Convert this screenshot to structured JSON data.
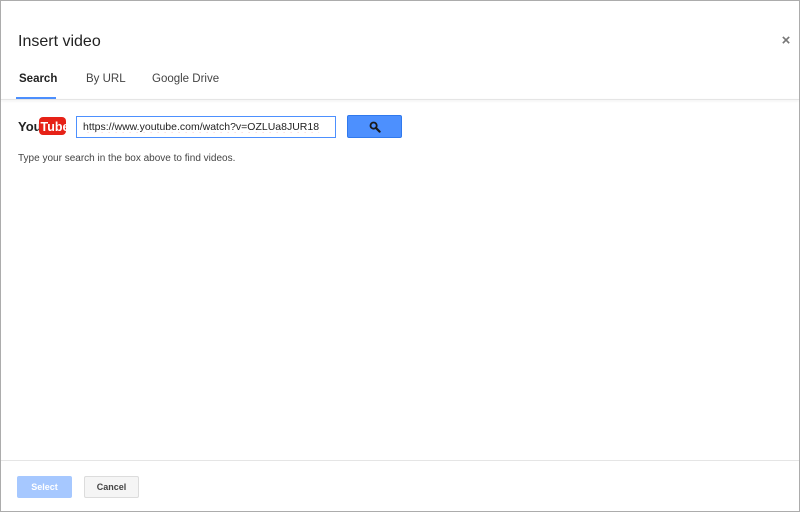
{
  "dialog": {
    "title": "Insert video",
    "close_label": "×"
  },
  "tabs": [
    {
      "label": "Search",
      "active": true
    },
    {
      "label": "By URL",
      "active": false
    },
    {
      "label": "Google Drive",
      "active": false
    }
  ],
  "search": {
    "logo_you": "You",
    "logo_tube": "Tube",
    "value": "https://www.youtube.com/watch?v=OZLUa8JUR18",
    "button_icon": "search-icon",
    "hint": "Type your search in the box above to find videos."
  },
  "footer": {
    "select_label": "Select",
    "cancel_label": "Cancel"
  },
  "colors": {
    "accent": "#4d90fe",
    "select_disabled": "#a6c8ff",
    "youtube_red": "#e62117"
  }
}
